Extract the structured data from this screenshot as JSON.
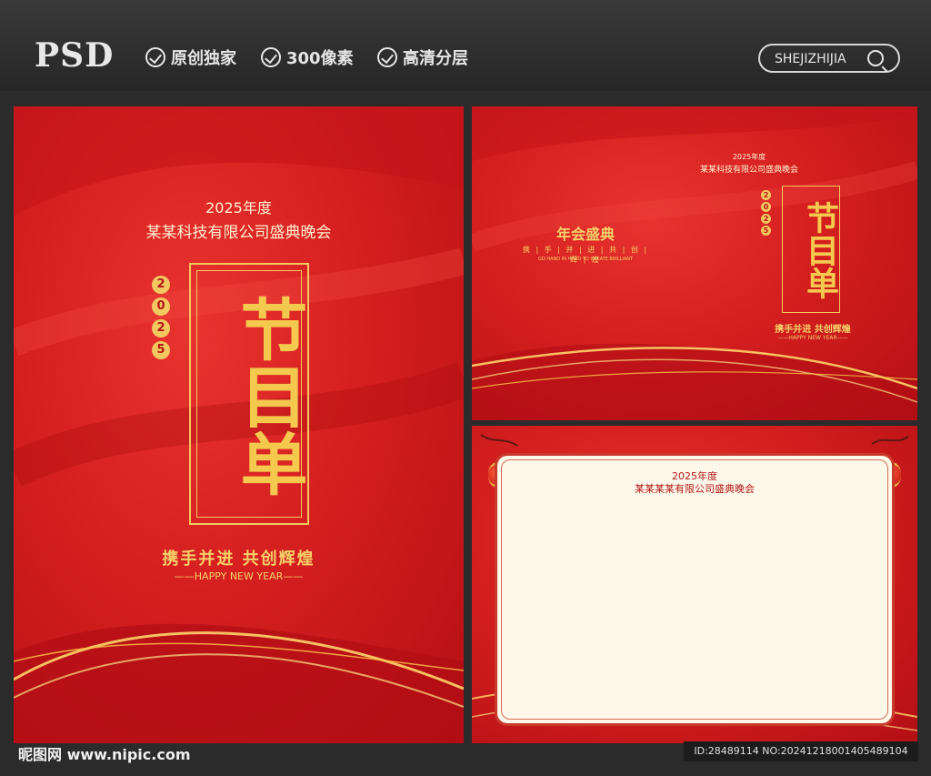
{
  "header": {
    "logo": "PSD",
    "features": [
      "原创独家",
      "300像素",
      "高清分层"
    ],
    "search_label": "SHEJIZHIJIA"
  },
  "panel_main": {
    "year_line": "2025年度",
    "company": "某某科技有限公司盛典晚会",
    "title": "节目单",
    "year_digits": [
      "2",
      "0",
      "2",
      "5"
    ],
    "slogan": "携手并进 共创辉煌",
    "english": "——HAPPY NEW YEAR——"
  },
  "panel_wide": {
    "year_line": "2025年度",
    "company": "某某科技有限公司盛典晚会",
    "title": "节目单",
    "year_digits": [
      "2",
      "0",
      "2",
      "5"
    ],
    "slogan": "携手并进 共创辉煌",
    "english": "——HAPPY NEW YEAR——",
    "left_title": "年会盛典",
    "left_sub": "携 | 手 | 并 | 进 | 共 | 创 | 辉 | 煌",
    "left_english": "GO HAND IN HAND TO CREATE BRILLIANT"
  },
  "panel_card": {
    "year_line": "2025年度",
    "company": "某某某某有限公司盛典晚会"
  },
  "footer": {
    "site": "昵图网 www.nipic.com",
    "id_text": "ID:28489114 NO:20241218001405489104"
  },
  "colors": {
    "red": "#d51f1f",
    "gold": "#f5c94e",
    "cream": "#fdf8ea",
    "dark_bg": "#2b2b2b"
  }
}
